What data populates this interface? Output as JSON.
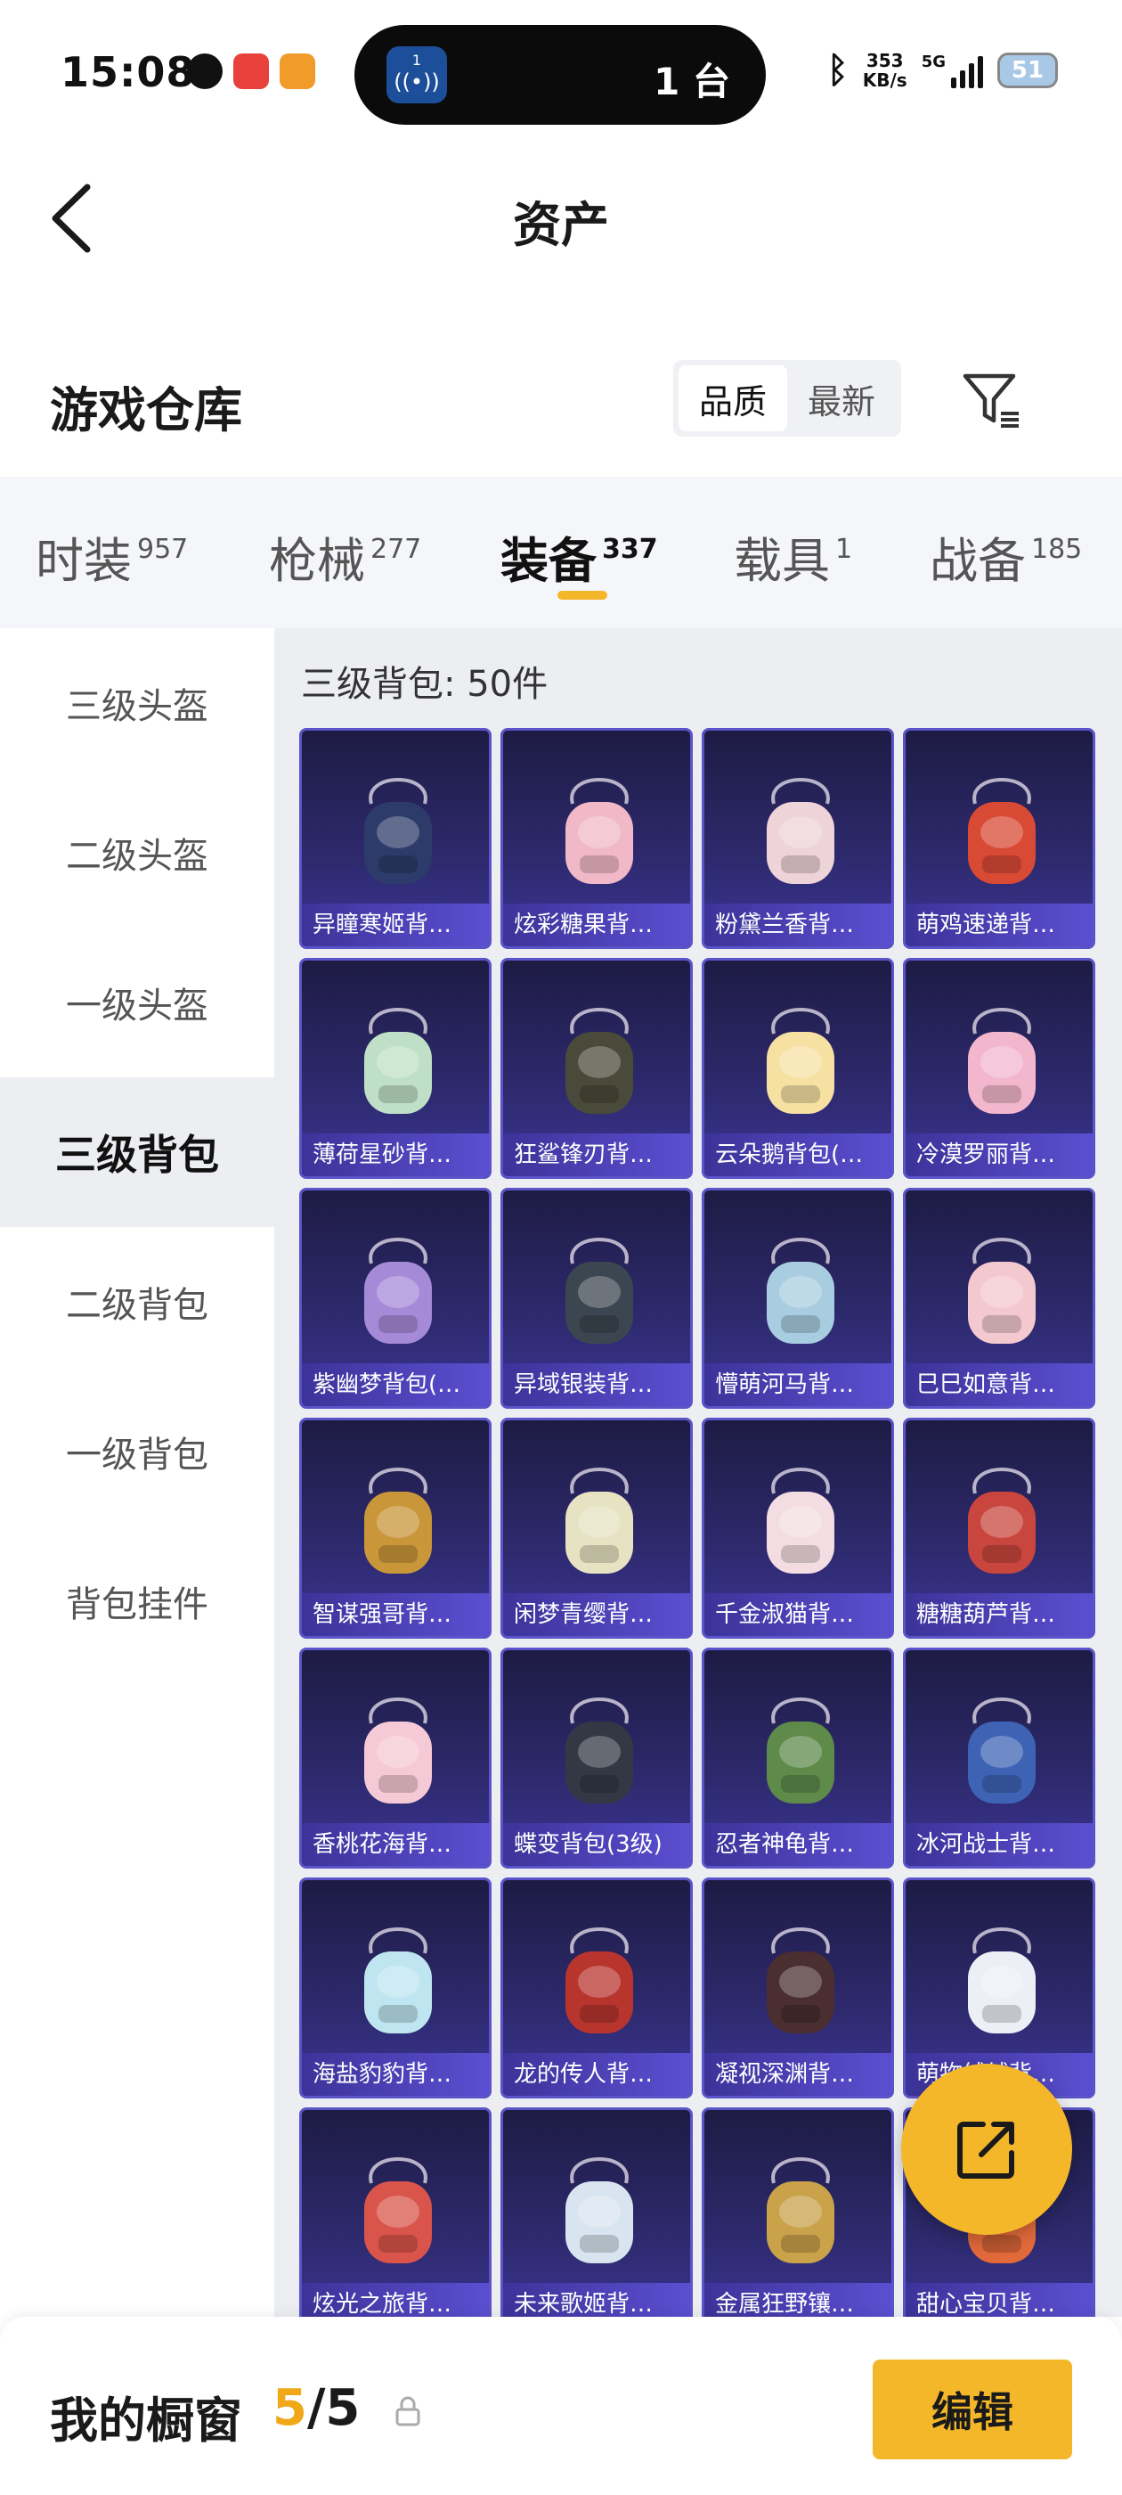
{
  "status_bar": {
    "time": "15:08",
    "island_badge": "1",
    "island_text": "1 台",
    "net_speed_value": "353",
    "net_speed_unit": "KB/s",
    "network": "5G",
    "battery": "51"
  },
  "nav": {
    "title": "资产"
  },
  "warehouse": {
    "title": "游戏仓库",
    "sort_options": [
      "品质",
      "最新"
    ],
    "active_sort": "品质"
  },
  "category_tabs": [
    {
      "label": "时装",
      "count": "957"
    },
    {
      "label": "枪械",
      "count": "277"
    },
    {
      "label": "装备",
      "count": "337"
    },
    {
      "label": "载具",
      "count": "1"
    },
    {
      "label": "战备",
      "count": "185"
    }
  ],
  "active_category": "装备",
  "sidebar": {
    "items": [
      "三级头盔",
      "二级头盔",
      "一级头盔",
      "三级背包",
      "二级背包",
      "一级背包",
      "背包挂件"
    ],
    "active": "三级背包"
  },
  "content": {
    "title": "三级背包: 50件",
    "items": [
      {
        "name": "异瞳寒姬背…",
        "art": "#2d3b6a"
      },
      {
        "name": "炫彩糖果背…",
        "art": "#f1b9c8"
      },
      {
        "name": "粉黛兰香背…",
        "art": "#eed3d8"
      },
      {
        "name": "萌鸡速递背…",
        "art": "#d94a35"
      },
      {
        "name": "薄荷星砂背…",
        "art": "#bfe0c6"
      },
      {
        "name": "狂鲨锋刃背…",
        "art": "#4a4a3a"
      },
      {
        "name": "云朵鹅背包(…",
        "art": "#f6e1a3"
      },
      {
        "name": "冷漠罗丽背…",
        "art": "#f2b7cc"
      },
      {
        "name": "紫幽梦背包(…",
        "art": "#a58ad8"
      },
      {
        "name": "异域银装背…",
        "art": "#3c4650"
      },
      {
        "name": "懵萌河马背…",
        "art": "#a8cde0"
      },
      {
        "name": "巳巳如意背…",
        "art": "#f3c8cf"
      },
      {
        "name": "智谋强哥背…",
        "art": "#c9963a"
      },
      {
        "name": "闲梦青缨背…",
        "art": "#e6e2c2"
      },
      {
        "name": "千金淑猫背…",
        "art": "#f3dde2"
      },
      {
        "name": "糖糖葫芦背…",
        "art": "#c9463e"
      },
      {
        "name": "香桃花海背…",
        "art": "#f6c9d6"
      },
      {
        "name": "蝶变背包(3级)",
        "art": "#333844"
      },
      {
        "name": "忍者神龟背…",
        "art": "#5e8a4a"
      },
      {
        "name": "冰河战士背…",
        "art": "#3e63b5"
      },
      {
        "name": "海盐豹豹背…",
        "art": "#bfe6f0"
      },
      {
        "name": "龙的传人背…",
        "art": "#b8352e"
      },
      {
        "name": "凝视深渊背…",
        "art": "#4a2e30"
      },
      {
        "name": "萌物绒绒背…",
        "art": "#eceff6"
      },
      {
        "name": "炫光之旅背…",
        "art": "#d9544a"
      },
      {
        "name": "未来歌姬背…",
        "art": "#d8e4f0"
      },
      {
        "name": "金属狂野镶…",
        "art": "#c9a24a"
      },
      {
        "name": "甜心宝贝背…",
        "art": "#e26a3a"
      }
    ]
  },
  "bottom_bar": {
    "label": "我的橱窗",
    "count_current": "5",
    "count_separator": "/5",
    "edit_label": "编辑"
  },
  "colors": {
    "accent": "#f5b72a",
    "card_bg": "#2e2a6e",
    "card_label": "#4f45c4",
    "content_bg": "#eceef2"
  }
}
